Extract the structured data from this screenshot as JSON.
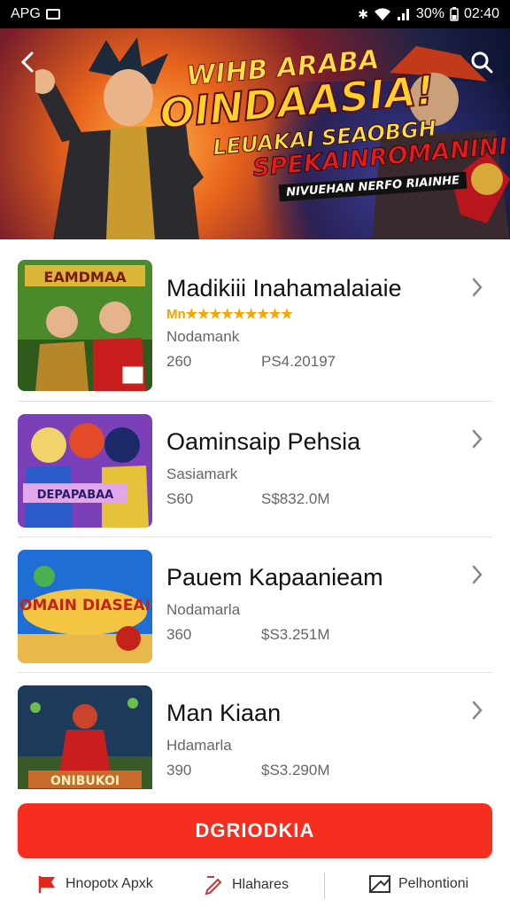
{
  "status_bar": {
    "carrier": "APG",
    "battery": "30%",
    "time": "02:40"
  },
  "banner": {
    "line1": "WIHB ARABA",
    "line2": "OINDAASIA!",
    "line3": "LEUAKAI SEAOBGH",
    "line4": "SPEKAINROMANINI!",
    "line5": "NIVUEHAN NERFO RIAINHE"
  },
  "apps": [
    {
      "name": "Madikiii Inahamalaiaie",
      "rating": "Mn★★★★★★★★★",
      "developer": "Nodamank",
      "size": "260",
      "price": "PS4.20197",
      "thumb_title": "EAMDMAA",
      "thumb_colors": [
        "#4a8a2a",
        "#d9b53a"
      ]
    },
    {
      "name": "Oaminsaip Pehsia",
      "rating": "",
      "developer": "Sasiamark",
      "size": "S60",
      "price": "S$832.0M",
      "thumb_title": "DEPAPABAA",
      "thumb_colors": [
        "#7b3fb8",
        "#e2a7e8"
      ]
    },
    {
      "name": "Pauem Kapaanieam",
      "rating": "",
      "developer": "Nodamarla",
      "size": "360",
      "price": "$S3.251M",
      "thumb_title": "BOMAIN DIASEAIA",
      "thumb_colors": [
        "#1f6ed6",
        "#f4c542"
      ]
    },
    {
      "name": "Man Kiaan",
      "rating": "",
      "developer": "Hdamarla",
      "size": "390",
      "price": "$S3.290M",
      "thumb_title": "ONIBUKOI",
      "thumb_colors": [
        "#1d3a5a",
        "#c96a2a"
      ]
    }
  ],
  "download_label": "DGRIODKIA",
  "bottom_nav": [
    {
      "label": "Hnopotx Apxk",
      "icon": "flag-icon"
    },
    {
      "label": "Hlahares",
      "icon": "edit-icon"
    },
    {
      "label": "Pelhontioni",
      "icon": "message-icon"
    }
  ],
  "colors": {
    "accent": "#f52e1f",
    "rating": "#f5a400"
  }
}
